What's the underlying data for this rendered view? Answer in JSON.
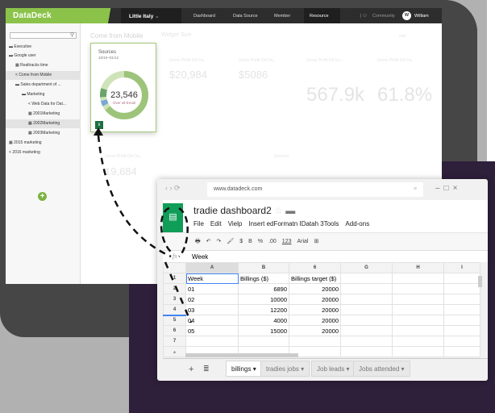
{
  "dashboard": {
    "brand": "DataDeck",
    "project": "Little Italy",
    "nav": [
      "Dashboard",
      "Data Source",
      "Member",
      "Resource"
    ],
    "community": "Community",
    "user": "William",
    "user_initial": "W",
    "sidebar": [
      "Executive",
      "Google user",
      "Realtracks time",
      "Come from Mobile",
      "Sales department of ...",
      "Marketing",
      "Web Data for Dat...",
      "2001Marketing",
      "2002Marketing",
      "2003Marketing",
      "2015 marketing",
      "2016 marketing"
    ],
    "page_title": "Come from Mobile",
    "widget_size": "Widget Size",
    "edit": "edit",
    "card": {
      "title": "Sources",
      "date": "10/10~01/12",
      "value": "23,546",
      "sub": "Over all Email"
    },
    "faded_cards": [
      {
        "title": "Gross Profit GA Da...",
        "value": "$20,984"
      },
      {
        "title": "Gross Profit GA Da...",
        "value": "$5086"
      },
      {
        "title": "Gross Profit GA Es...",
        "value": "567.9k"
      },
      {
        "title": "Gross Profit GA Da...",
        "value": "61.8%"
      },
      {
        "title": "Gross Profit GA Da...",
        "value": "19,684"
      },
      {
        "title": "Sources",
        "value": ""
      }
    ]
  },
  "sheet": {
    "url": "www.datadeck.com",
    "title": "tradie dashboard2",
    "menus": [
      "File",
      "Edit",
      "Vielp",
      "Insert edFormatn IDatah 3Tools",
      "Add-ons"
    ],
    "toolbar": [
      "🖶",
      "↶",
      "↷",
      "🖌",
      "$",
      "B",
      "%",
      ".00",
      "123",
      "Arial",
      "⊞"
    ],
    "formula": "Week",
    "fx": "fx",
    "columns": [
      "A",
      "B",
      "6",
      "G",
      "H",
      "I"
    ],
    "rows": [
      [
        "1",
        "Week",
        "Billings ($)",
        "Billings target ($)"
      ],
      [
        "2",
        "01",
        "6890",
        "20000"
      ],
      [
        "3",
        "02",
        "10000",
        "20000"
      ],
      [
        "4",
        "03",
        "12200",
        "20000"
      ],
      [
        "5",
        "04",
        "4000",
        "20000"
      ],
      [
        "6",
        "05",
        "15000",
        "20000"
      ],
      [
        "7",
        "",
        "",
        ""
      ],
      [
        "8",
        "",
        "",
        ""
      ]
    ],
    "tabs": [
      "billings",
      "tradies jobs",
      "Job leads",
      "Jobs attended"
    ]
  },
  "colors": {
    "accent": "#8bc34a",
    "sheets_green": "#0f9d58",
    "purple_bg": "#2e1f3b"
  }
}
